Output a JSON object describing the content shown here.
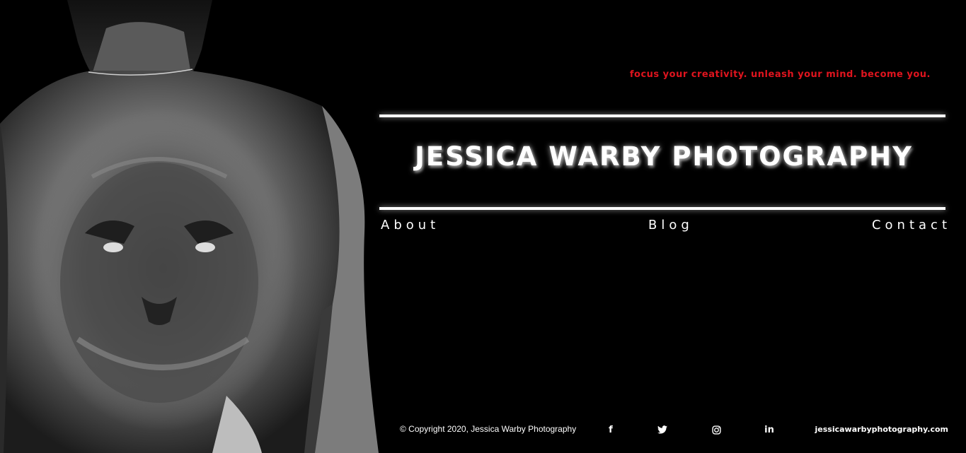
{
  "header": {
    "tagline": "focus your creativity. unleash your mind. become you.",
    "site_title": "JESSICA WARBY PHOTOGRAPHY"
  },
  "nav": {
    "items": [
      {
        "label": "About"
      },
      {
        "label": "Blog"
      },
      {
        "label": "Contact"
      }
    ]
  },
  "footer": {
    "copyright": "© Copyright 2020, Jessica Warby Photography",
    "social": [
      {
        "icon": "facebook-icon",
        "glyph": "f"
      },
      {
        "icon": "twitter-icon"
      },
      {
        "icon": "instagram-icon"
      },
      {
        "icon": "linkedin-icon",
        "glyph": "in"
      }
    ],
    "website": "jessicawarbyphotography.com"
  },
  "colors": {
    "background": "#000000",
    "accent": "#e0141e",
    "text": "#ffffff"
  }
}
